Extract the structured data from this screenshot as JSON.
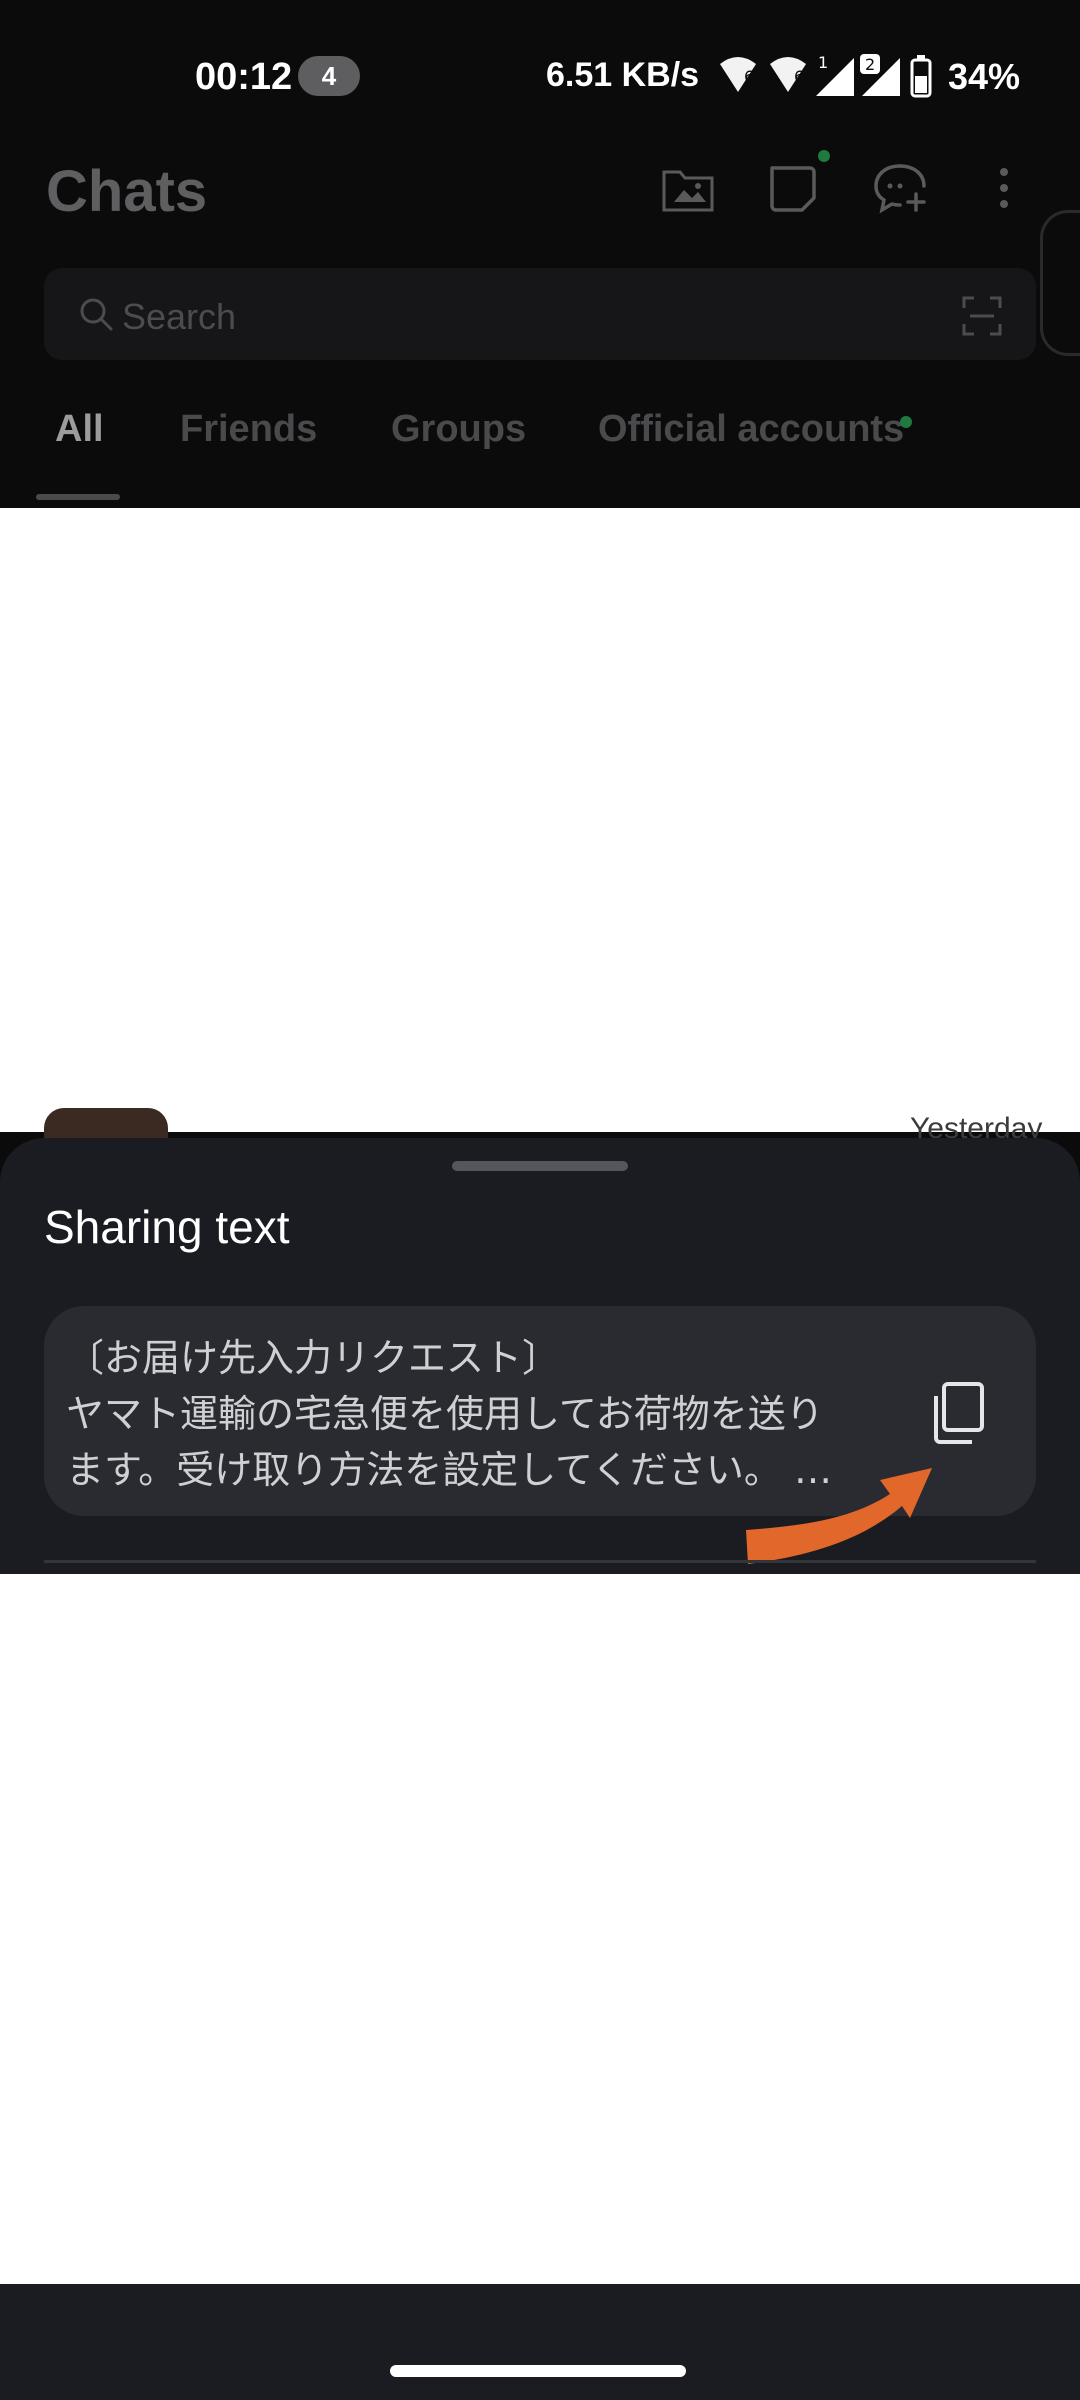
{
  "status_bar": {
    "time": "00:12",
    "notification_count": "4",
    "network_speed": "6.51 KB/s",
    "battery": "34%"
  },
  "header": {
    "title": "Chats",
    "search_placeholder": "Search",
    "tabs": [
      {
        "label": "All",
        "active": true
      },
      {
        "label": "Friends",
        "active": false
      },
      {
        "label": "Groups",
        "active": false
      },
      {
        "label": "Official accounts",
        "active": false
      }
    ]
  },
  "list_peek": {
    "timestamp": "Yesterday"
  },
  "sheet": {
    "title": "Sharing text",
    "text_lines": [
      "〔お届け先入力リクエスト〕",
      "ヤマト運輸の宅急便を使用してお荷物を送り",
      "ます。受け取り方法を設定してください。 …"
    ]
  },
  "colors": {
    "accent_arrow": "#e2672a",
    "online_dot": "#1e7a3e",
    "sheet_bg": "#1b1c22",
    "card_bg": "#2a2b31"
  }
}
